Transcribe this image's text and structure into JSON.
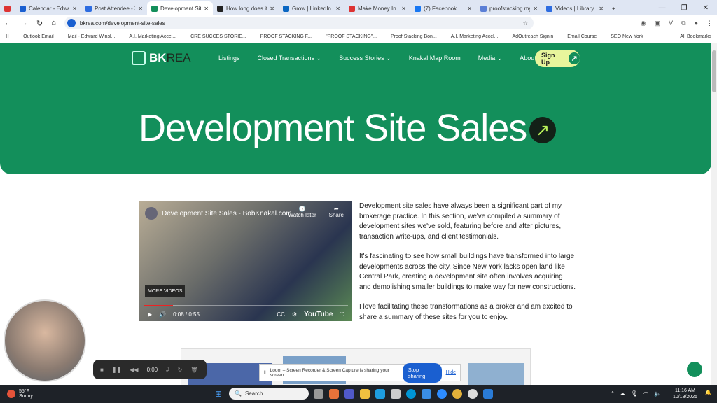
{
  "browser": {
    "tabs": [
      {
        "label": "",
        "color": "#d33"
      },
      {
        "label": "Calendar - Edward W",
        "color": "#1a5fd0"
      },
      {
        "label": "Post Attendee - Zoo",
        "color": "#2d6ce0"
      },
      {
        "label": "Development Site Sales",
        "color": "#138f5b",
        "active": true
      },
      {
        "label": "How long does it ta",
        "color": "#222"
      },
      {
        "label": "Grow | LinkedIn",
        "color": "#0a66c2"
      },
      {
        "label": "Make Money In Loc",
        "color": "#d33"
      },
      {
        "label": "(7) Facebook",
        "color": "#1877f2"
      },
      {
        "label": "proofstacking.mysi",
        "color": "#5b7fd6"
      },
      {
        "label": "Videos | Library | Lo",
        "color": "#2d6ce0"
      }
    ],
    "url": "bkrea.com/development-site-sales",
    "bookmarks": [
      "Outlook Email",
      "Mail - Edward Winsl...",
      "A.I. Marketing Accel...",
      "CRE SUCCES STORIE...",
      "PROOF STACKING F...",
      "\"PROOF STACKING\"...",
      "Proof Stacking Bon...",
      "A.I. Marketing Accel...",
      "AdOutreach Signin",
      "Email Course",
      "SEO New York"
    ],
    "all_bookmarks": "All Bookmarks"
  },
  "site": {
    "logo": {
      "bk": "BK",
      "rea": "REA"
    },
    "nav": [
      "Listings",
      "Closed Transactions ⌄",
      "Success Stories ⌄",
      "Knakal Map Room",
      "Media ⌄",
      "About ⌄"
    ],
    "signup": "Sign Up",
    "page_title": "Development Site Sales",
    "accent": "#138f5b",
    "video": {
      "title": "Development Site Sales - BobKnakal.com",
      "watch_later": "Watch later",
      "share": "Share",
      "more_videos": "MORE VIDEOS",
      "time": "0:08 / 0:55",
      "progress": 0.145,
      "youtube": "YouTube"
    },
    "paragraphs": [
      "Development site sales have always been a significant part of my brokerage practice. In this section, we've compiled a summary of development sites we've sold, featuring before and after pictures, transaction write-ups, and client testimonials.",
      "It's fascinating to see how small buildings have transformed into large developments across the city. Since New York lacks open land like Central Park, creating a development site often involves acquiring and demolishing smaller buildings to make way for new constructions.",
      "I love facilitating these transformations as a broker and am excited to share a summary of these sites for you to enjoy."
    ]
  },
  "loom": {
    "timer": "0:00",
    "share_msg": "Loom – Screen Recorder & Screen Capture is sharing your screen.",
    "stop": "Stop sharing",
    "hide": "Hide"
  },
  "taskbar": {
    "temp": "55°F",
    "weather": "Sunny",
    "search": "Search",
    "time": "11:16 AM",
    "date": "10/18/2025"
  }
}
